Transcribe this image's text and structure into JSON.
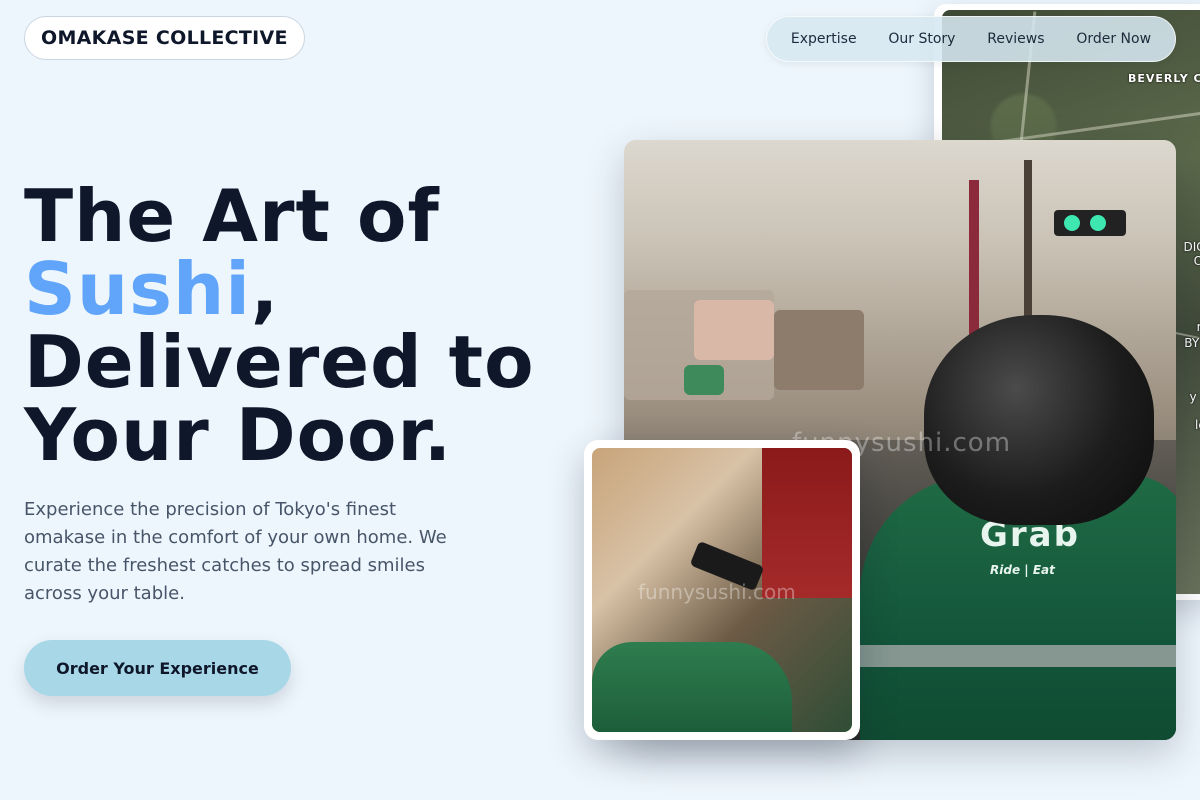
{
  "brand": {
    "name": "OMAKASE COLLECTIVE"
  },
  "nav": {
    "items": [
      {
        "label": "Expertise"
      },
      {
        "label": "Our Story"
      },
      {
        "label": "Reviews"
      },
      {
        "label": "Order Now"
      }
    ]
  },
  "hero": {
    "title_line1": "The Art of",
    "title_accent": "Sushi",
    "title_comma": ",",
    "title_line3": "Delivered to",
    "title_line4": "Your Door.",
    "description": "Experience the precision of Tokyo's finest omakase in the comfort of your own home. We curate the freshest catches to spread smiles across your table.",
    "cta_label": "Order Your Experience"
  },
  "map": {
    "label_top": "BEVERLY CR",
    "side_labels": [
      "DICT",
      "ON",
      "rly",
      "BY H",
      "y of",
      "les"
    ]
  },
  "photos": {
    "watermark_main": "funnysushi.com",
    "watermark_small": "funnysushi.com",
    "jacket_logo": "Grab",
    "jacket_sub": "Ride | Eat"
  },
  "colors": {
    "background": "#eef6fd",
    "accent": "#60a5fa",
    "cta_background": "#a8d8e8",
    "text_dark": "#0f172a",
    "text_muted": "#475569"
  }
}
